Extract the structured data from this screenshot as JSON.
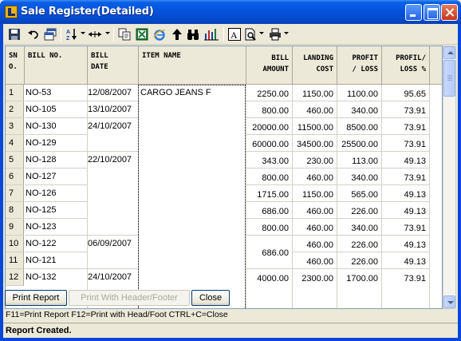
{
  "window": {
    "title": "Sale Register(Detailed)"
  },
  "toolbar": {
    "buttons": [
      "save-icon",
      "undo-icon",
      "copy-window-icon",
      "sort-az-icon",
      "column-width-icon",
      "copy-icon",
      "excel-icon",
      "internet-explorer-icon",
      "up-arrow-icon",
      "binoculars-icon",
      "bar-chart-icon",
      "font-icon",
      "print-preview-icon",
      "printer-icon"
    ]
  },
  "columns": {
    "sno": "SN\nO.",
    "bill_no": "BILL NO.",
    "bill_date": "BILL\nDATE",
    "item_name": "ITEM NAME",
    "bill_amount": "BILL\nAMOUNT",
    "landing_cost": "LANDING\nCOST",
    "profit_loss": "PROFIT\n/ LOSS",
    "profit_loss_pct": "PROFIL/\nLOSS %"
  },
  "rows": [
    {
      "sno": "1",
      "bill_no": "NO-53",
      "bill_date": "12/08/2007",
      "item_name": "CARGO JEANS F",
      "bill_amount": "2250.00",
      "landing_cost": "1150.00",
      "profit_loss": "1100.00",
      "pct": "95.65"
    },
    {
      "sno": "2",
      "bill_no": "NO-105",
      "bill_date": "13/10/2007",
      "item_name": "",
      "bill_amount": "800.00",
      "landing_cost": "460.00",
      "profit_loss": "340.00",
      "pct": "73.91"
    },
    {
      "sno": "3",
      "bill_no": "NO-130",
      "bill_date": "24/10/2007",
      "item_name": "",
      "bill_amount": "20000.00",
      "landing_cost": "11500.00",
      "profit_loss": "8500.00",
      "pct": "73.91"
    },
    {
      "sno": "4",
      "bill_no": "NO-129",
      "bill_date": "",
      "item_name": "",
      "bill_amount": "60000.00",
      "landing_cost": "34500.00",
      "profit_loss": "25500.00",
      "pct": "73.91"
    },
    {
      "sno": "5",
      "bill_no": "NO-128",
      "bill_date": "22/10/2007",
      "item_name": "",
      "bill_amount": "343.00",
      "landing_cost": "230.00",
      "profit_loss": "113.00",
      "pct": "49.13"
    },
    {
      "sno": "6",
      "bill_no": "NO-127",
      "bill_date": "",
      "item_name": "",
      "bill_amount": "800.00",
      "landing_cost": "460.00",
      "profit_loss": "340.00",
      "pct": "73.91"
    },
    {
      "sno": "7",
      "bill_no": "NO-126",
      "bill_date": "",
      "item_name": "",
      "bill_amount": "1715.00",
      "landing_cost": "1150.00",
      "profit_loss": "565.00",
      "pct": "49.13"
    },
    {
      "sno": "8",
      "bill_no": "NO-125",
      "bill_date": "",
      "item_name": "",
      "bill_amount": "686.00",
      "landing_cost": "460.00",
      "profit_loss": "226.00",
      "pct": "49.13"
    },
    {
      "sno": "9",
      "bill_no": "NO-123",
      "bill_date": "",
      "item_name": "",
      "bill_amount": "800.00",
      "landing_cost": "460.00",
      "profit_loss": "340.00",
      "pct": "73.91"
    },
    {
      "sno": "10",
      "bill_no": "NO-122",
      "bill_date": "06/09/2007",
      "item_name": "",
      "bill_amount": "686.00",
      "landing_cost": "460.00",
      "profit_loss": "226.00",
      "pct": "49.13"
    },
    {
      "sno": "11",
      "bill_no": "NO-121",
      "bill_date": "",
      "item_name": "",
      "bill_amount": "",
      "landing_cost": "460.00",
      "profit_loss": "226.00",
      "pct": "49.13"
    },
    {
      "sno": "12",
      "bill_no": "NO-132",
      "bill_date": "24/10/2007",
      "item_name": "",
      "bill_amount": "4000.00",
      "landing_cost": "2300.00",
      "profit_loss": "1700.00",
      "pct": "73.91"
    }
  ],
  "buttons": {
    "print_report": "Print Report",
    "print_header_footer": "Print With Header/Footer",
    "close": "Close"
  },
  "hint": "F11=Print Report  F12=Print with Head/Foot  CTRL+C=Close",
  "status": "Report Created.",
  "colors": {
    "titlebar": "#0553dc",
    "face": "#ece9d8",
    "grid_border": "#7f9db9"
  }
}
